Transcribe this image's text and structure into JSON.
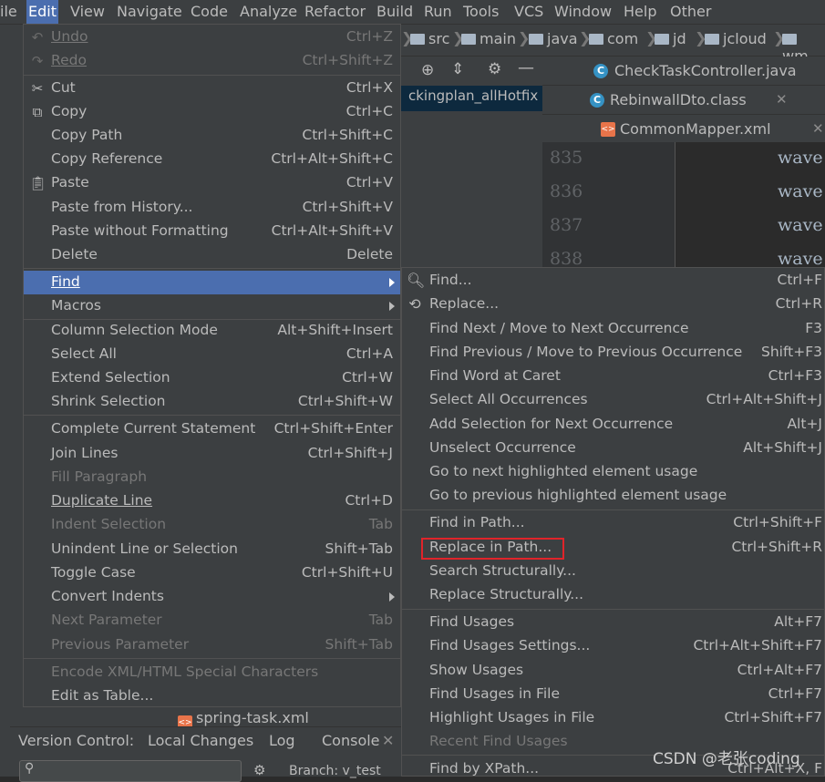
{
  "menubar": {
    "items": [
      "ile",
      "Edit",
      "View",
      "Navigate",
      "Code",
      "Analyze",
      "Refactor",
      "Build",
      "Run",
      "Tools",
      "VCS",
      "Window",
      "Help",
      "Other"
    ]
  },
  "breadcrumb": [
    "src",
    "main",
    "java",
    "com",
    "jd",
    "jcloud",
    "wm"
  ],
  "project_tree_text": "ckingplan_allHotfix",
  "tabs": [
    {
      "label": "CheckTaskController.java"
    },
    {
      "label": "RebinwallDto.class"
    },
    {
      "label": "CommonMapper.xml"
    }
  ],
  "editor": {
    "line_numbers": [
      "835",
      "836",
      "837",
      "838"
    ],
    "code": [
      "wave",
      "wave",
      "wave",
      "wave"
    ]
  },
  "edit_menu": {
    "items": [
      {
        "label": "Undo",
        "shortcut": "Ctrl+Z",
        "icon": "undo-icon",
        "disabled": true
      },
      {
        "label": "Redo",
        "shortcut": "Ctrl+Shift+Z",
        "icon": "redo-icon",
        "disabled": true
      },
      {
        "label": "Cut",
        "shortcut": "Ctrl+X",
        "icon": "scissors-icon"
      },
      {
        "label": "Copy",
        "shortcut": "Ctrl+C",
        "icon": "copy-icon"
      },
      {
        "label": "Copy Path",
        "shortcut": "Ctrl+Shift+C"
      },
      {
        "label": "Copy Reference",
        "shortcut": "Ctrl+Alt+Shift+C"
      },
      {
        "label": "Paste",
        "shortcut": "Ctrl+V",
        "icon": "clipboard-icon"
      },
      {
        "label": "Paste from History...",
        "shortcut": "Ctrl+Shift+V"
      },
      {
        "label": "Paste without Formatting",
        "shortcut": "Ctrl+Alt+Shift+V"
      },
      {
        "label": "Delete",
        "shortcut": "Delete"
      },
      {
        "label": "Find",
        "shortcut": "",
        "selected": true,
        "submenu": true
      },
      {
        "label": "Macros",
        "shortcut": "",
        "submenu": true
      },
      {
        "label": "Column Selection Mode",
        "shortcut": "Alt+Shift+Insert"
      },
      {
        "label": "Select All",
        "shortcut": "Ctrl+A"
      },
      {
        "label": "Extend Selection",
        "shortcut": "Ctrl+W"
      },
      {
        "label": "Shrink Selection",
        "shortcut": "Ctrl+Shift+W"
      },
      {
        "label": "Complete Current Statement",
        "shortcut": "Ctrl+Shift+Enter"
      },
      {
        "label": "Join Lines",
        "shortcut": "Ctrl+Shift+J"
      },
      {
        "label": "Fill Paragraph",
        "shortcut": "",
        "disabled": true
      },
      {
        "label": "Duplicate Line",
        "shortcut": "Ctrl+D"
      },
      {
        "label": "Indent Selection",
        "shortcut": "Tab",
        "disabled": true
      },
      {
        "label": "Unindent Line or Selection",
        "shortcut": "Shift+Tab"
      },
      {
        "label": "Toggle Case",
        "shortcut": "Ctrl+Shift+U"
      },
      {
        "label": "Convert Indents",
        "shortcut": "",
        "submenu": true
      },
      {
        "label": "Next Parameter",
        "shortcut": "Tab",
        "disabled": true
      },
      {
        "label": "Previous Parameter",
        "shortcut": "Shift+Tab",
        "disabled": true
      },
      {
        "label": "Encode XML/HTML Special Characters",
        "shortcut": "",
        "disabled": true
      },
      {
        "label": "Edit as Table...",
        "shortcut": ""
      }
    ]
  },
  "find_menu": {
    "items": [
      {
        "label": "Find...",
        "shortcut": "Ctrl+F",
        "icon": "search-icon"
      },
      {
        "label": "Replace...",
        "shortcut": "Ctrl+R",
        "icon": "replace-icon"
      },
      {
        "label": "Find Next / Move to Next Occurrence",
        "shortcut": "F3"
      },
      {
        "label": "Find Previous / Move to Previous Occurrence",
        "shortcut": "Shift+F3"
      },
      {
        "label": "Find Word at Caret",
        "shortcut": "Ctrl+F3"
      },
      {
        "label": "Select All Occurrences",
        "shortcut": "Ctrl+Alt+Shift+J"
      },
      {
        "label": "Add Selection for Next Occurrence",
        "shortcut": "Alt+J"
      },
      {
        "label": "Unselect Occurrence",
        "shortcut": "Alt+Shift+J"
      },
      {
        "label": "Go to next highlighted element usage",
        "shortcut": ""
      },
      {
        "label": "Go to previous highlighted element usage",
        "shortcut": ""
      },
      {
        "label": "Find in Path...",
        "shortcut": "Ctrl+Shift+F"
      },
      {
        "label": "Replace in Path...",
        "shortcut": "Ctrl+Shift+R",
        "highlighted": true
      },
      {
        "label": "Search Structurally...",
        "shortcut": ""
      },
      {
        "label": "Replace Structurally...",
        "shortcut": ""
      },
      {
        "label": "Find Usages",
        "shortcut": "Alt+F7"
      },
      {
        "label": "Find Usages Settings...",
        "shortcut": "Ctrl+Alt+Shift+F7"
      },
      {
        "label": "Show Usages",
        "shortcut": "Ctrl+Alt+F7"
      },
      {
        "label": "Find Usages in File",
        "shortcut": "Ctrl+F7"
      },
      {
        "label": "Highlight Usages in File",
        "shortcut": "Ctrl+Shift+F7"
      },
      {
        "label": "Recent Find Usages",
        "shortcut": "",
        "disabled": true
      },
      {
        "label": "Find by XPath...",
        "shortcut": "Ctrl+Alt+X, F"
      }
    ]
  },
  "bottom_tabs": [
    "Version Control:",
    "Local Changes",
    "Log",
    "Console"
  ],
  "spring_file": "spring-task.xml",
  "branch": "Branch: v_test",
  "watermark": "CSDN @老张coding",
  "colors": {
    "accent": "#4b6eaf",
    "menu_bg": "#3c3f41",
    "highlight_box": "#e0242a"
  }
}
